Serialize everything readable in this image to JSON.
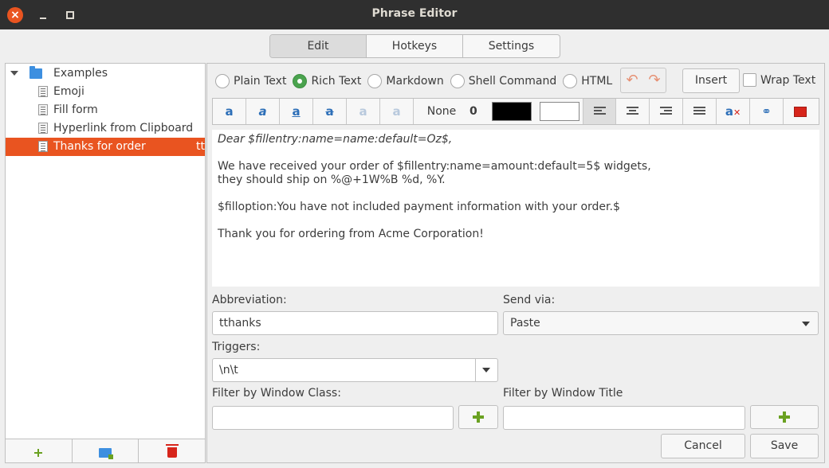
{
  "window": {
    "title": "Phrase Editor"
  },
  "tabs": [
    {
      "label": "Edit",
      "active": true
    },
    {
      "label": "Hotkeys",
      "active": false
    },
    {
      "label": "Settings",
      "active": false
    }
  ],
  "tree": {
    "folder": "Examples",
    "items": [
      {
        "label": "Emoji"
      },
      {
        "label": "Fill form"
      },
      {
        "label": "Hyperlink from Clipboard"
      },
      {
        "label": "Thanks for order",
        "abbr": "tt",
        "selected": true
      }
    ]
  },
  "modes": [
    {
      "label": "Plain Text",
      "checked": false
    },
    {
      "label": "Rich Text",
      "checked": true
    },
    {
      "label": "Markdown",
      "checked": false
    },
    {
      "label": "Shell Command",
      "checked": false
    },
    {
      "label": "HTML",
      "checked": false
    }
  ],
  "toolbar": {
    "undo_icon": "↶",
    "redo_icon": "↷",
    "insert_label": "Insert",
    "wrap_label": "Wrap Text",
    "wrap_checked": false
  },
  "format": {
    "bold_glyph": "a",
    "italic_glyph": "a",
    "underline_glyph": "a",
    "strike_glyph": "a",
    "sup_glyph": "a",
    "sub_glyph": "a",
    "font_name": "None",
    "font_size": "0",
    "fg_color": "#000000",
    "bg_color": "#ffffff"
  },
  "editor": {
    "lines": [
      "Dear $fillentry:name=name:default=Oz$,",
      "We have received your order of $fillentry:name=amount:default=5$ widgets,\nthey should ship on %@+1W%B %d, %Y.",
      "$filloption:You have not included payment information with your order.$",
      "Thank you for ordering from Acme Corporation!"
    ]
  },
  "form": {
    "abbreviation_label": "Abbreviation:",
    "abbreviation_value": "tthanks",
    "send_via_label": "Send via:",
    "send_via_value": "Paste",
    "triggers_label": "Triggers:",
    "triggers_value": "\\n\\t",
    "filter_class_label": "Filter by Window Class:",
    "filter_class_value": "",
    "filter_title_label": "Filter by Window Title",
    "filter_title_value": ""
  },
  "buttons": {
    "cancel": "Cancel",
    "save": "Save"
  }
}
